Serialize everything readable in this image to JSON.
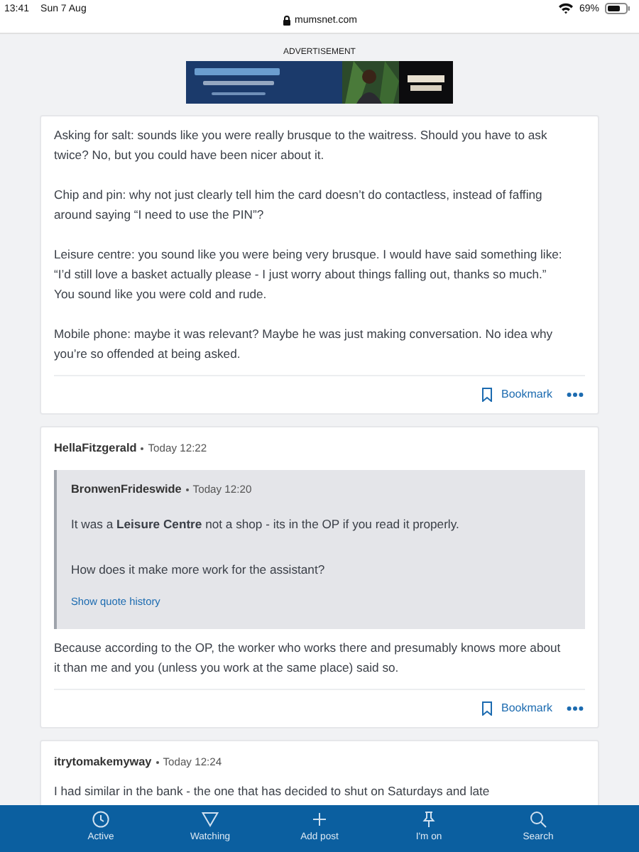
{
  "status_bar": {
    "time": "13:41",
    "date": "Sun 7 Aug",
    "battery": "69%"
  },
  "address_bar": {
    "url": "mumsnet.com"
  },
  "advertisement": {
    "label": "ADVERTISEMENT"
  },
  "posts": [
    {
      "paragraphs": [
        "Asking for salt: sounds like you were really brusque to the waitress. Should you have to ask twice? No, but you could have been nicer about it.",
        "Chip and pin: why not just clearly tell him the card doesn’t do contactless, instead of faffing around saying “I need to use the PIN”?",
        "Leisure centre: you sound like you were being very brusque. I would have said something like: “I’d still love a basket actually please - I just worry about things falling out, thanks so much.” You sound like you were cold and rude.",
        "Mobile phone: maybe it was relevant? Maybe he was just making conversation. No idea why you’re so offended at being asked."
      ],
      "bookmark": "Bookmark"
    },
    {
      "author": "HellaFitzgerald",
      "time": "Today 12:22",
      "quote": {
        "author": "BronwenFrideswide",
        "time": "Today 12:20",
        "paragraphs": [
          "It was a **Leisure Centre** not a shop - its in the OP if you read it properly.",
          "How does it make more work for the assistant?"
        ],
        "history_link": "Show quote history"
      },
      "paragraphs": [
        "Because according to the OP, the worker who works there and presumably knows more about it than me and you (unless you work at the same place) said so."
      ],
      "bookmark": "Bookmark"
    },
    {
      "author": "itrytomakemyway",
      "time": "Today 12:24",
      "paragraphs": [
        "I had similar in the bank - the one that has decided to shut on Saturdays and late"
      ]
    }
  ],
  "bottom_nav": [
    {
      "kind": "clock",
      "label": "Active"
    },
    {
      "kind": "filter",
      "label": "Watching"
    },
    {
      "kind": "plus",
      "label": "Add post"
    },
    {
      "kind": "pin",
      "label": "I'm on"
    },
    {
      "kind": "search",
      "label": "Search"
    }
  ]
}
